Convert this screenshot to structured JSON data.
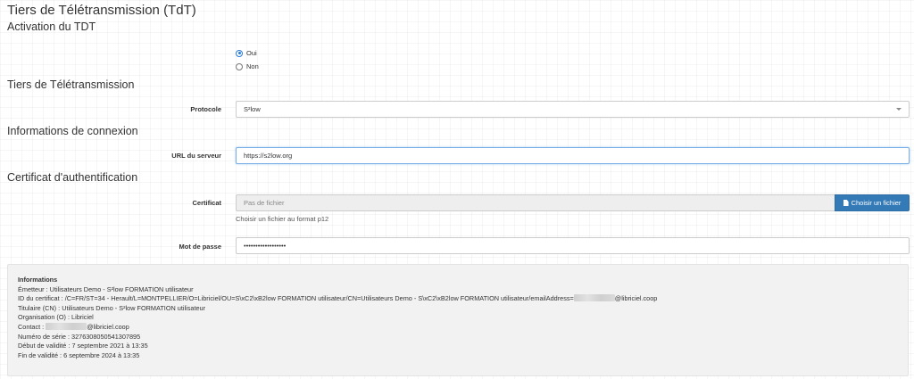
{
  "page_title": "Tiers de Télétransmission (TdT)",
  "activation": {
    "heading": "Activation du TDT",
    "options": [
      "Oui",
      "Non"
    ],
    "selected": "Oui"
  },
  "tdt": {
    "heading": "Tiers de Télétransmission",
    "protocol_label": "Protocole",
    "protocol_value": "S²low"
  },
  "connection": {
    "heading": "Informations de connexion",
    "url_label": "URL du serveur",
    "url_value": "https://s2low.org"
  },
  "certificate": {
    "heading": "Certificat d'authentification",
    "cert_label": "Certificat",
    "file_placeholder": "Pas de fichier",
    "choose_button": "Choisir un fichier",
    "help_text": "Choisir un fichier au format p12",
    "password_label": "Mot de passe",
    "password_value": "••••••••••••••••••"
  },
  "info": {
    "title": "Informations",
    "emetteur": "Émetteur : Utilisateurs Demo - S²low FORMATION utilisateur",
    "id_prefix": "ID du certificat : /C=FR/ST=34 - Herault/L=MONTPELLIER/O=Libriciel/OU=S\\xC2\\xB2low FORMATION utilisateur/CN=Utilisateurs Demo - S\\xC2\\xB2low FORMATION utilisateur/emailAddress=",
    "id_suffix": "@libriciel.coop",
    "titulaire": "Titulaire (CN) : Utilisateurs Demo - S²low FORMATION utilisateur",
    "organisation": "Organisation (O) : Libriciel",
    "contact_prefix": "Contact : ",
    "contact_suffix": "@libriciel.coop",
    "serial": "Numéro de série : 3276308050541307895",
    "start": "Début de validité : 7 septembre 2021 à 13:35",
    "end": "Fin de validité : 6 septembre 2024 à 13:35"
  }
}
